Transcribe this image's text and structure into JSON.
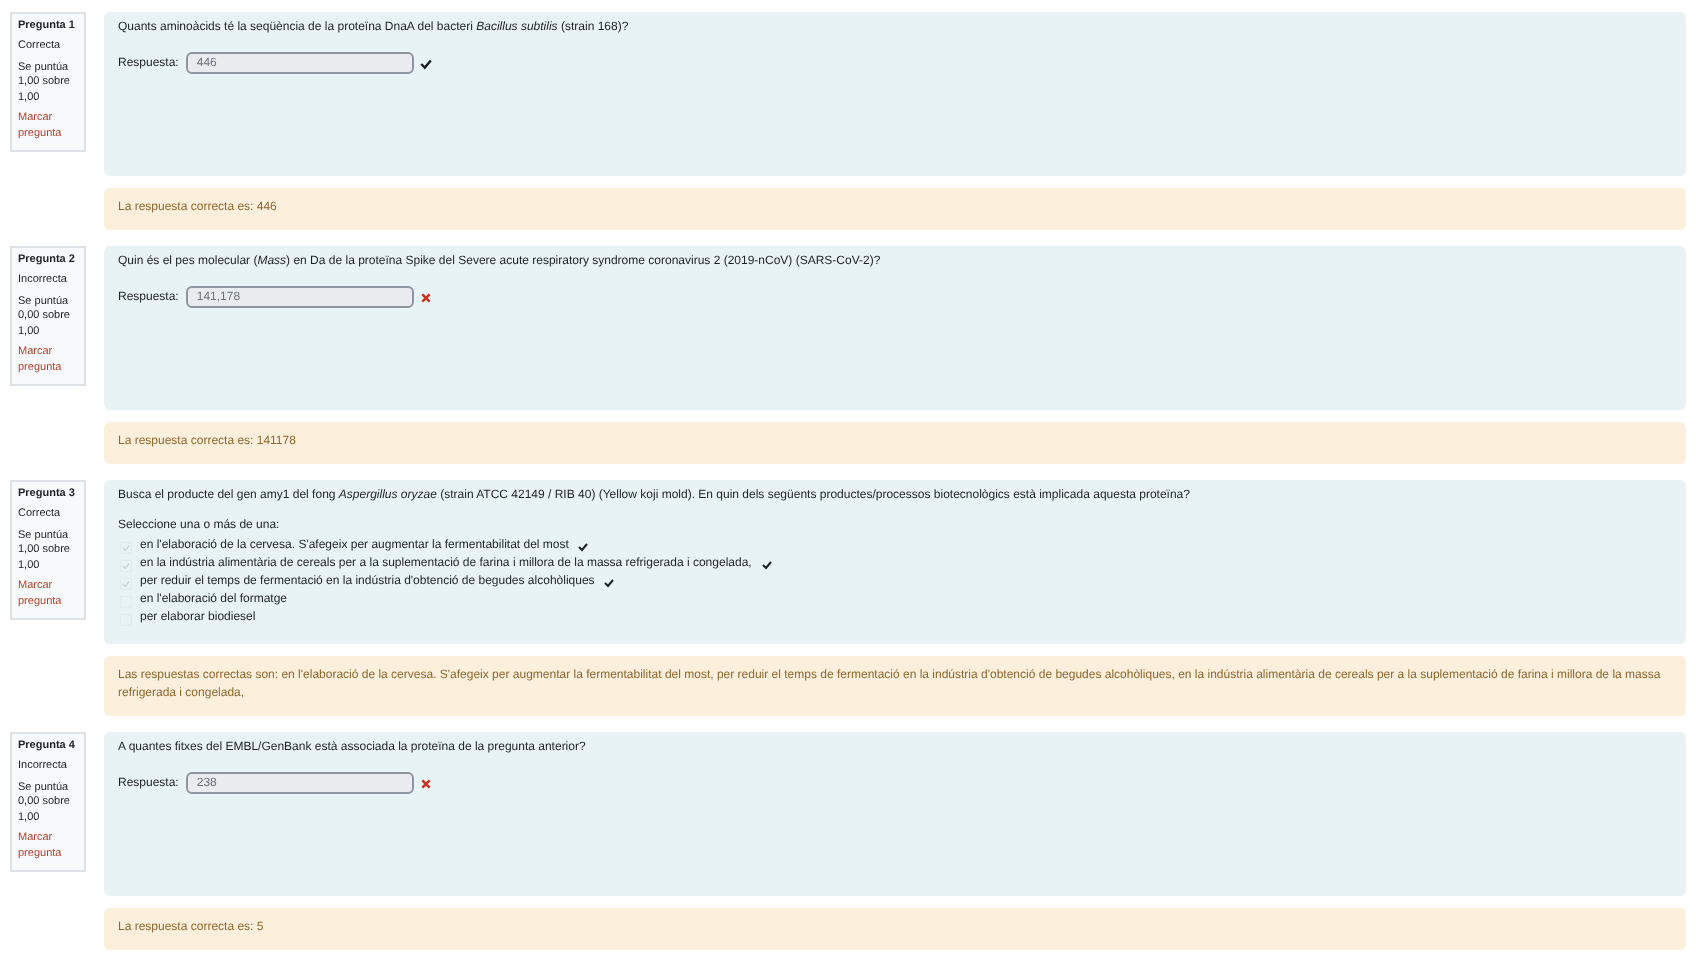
{
  "questions": [
    {
      "number": "Pregunta 1",
      "status": "Correcta",
      "score": "Se puntúa 1,00 sobre 1,00",
      "flag": "Marcar pregunta",
      "kind": "short",
      "prompt": "Quants aminoàcids té la seqüència de la proteïna DnaA del bacteri *Bacillus subtilis* (strain 168)?",
      "answer_label": "Respuesta:",
      "answer": "446",
      "correct": true,
      "feedback": "La respuesta correcta es: 446"
    },
    {
      "number": "Pregunta 2",
      "status": "Incorrecta",
      "score": "Se puntúa 0,00 sobre 1,00",
      "flag": "Marcar pregunta",
      "kind": "short",
      "prompt": "Quin és el pes molecular (*Mass*) en Da de la proteïna Spike del Severe acute respiratory syndrome coronavirus 2 (2019-nCoV) (SARS-CoV-2)?",
      "answer_label": "Respuesta:",
      "answer": "141,178",
      "correct": false,
      "feedback": "La respuesta correcta es: 141178"
    },
    {
      "number": "Pregunta 3",
      "status": "Correcta",
      "score": "Se puntúa 1,00 sobre 1,00",
      "flag": "Marcar pregunta",
      "kind": "multi",
      "prompt": "Busca el producte del gen amy1 del fong *Aspergillus oryzae* (strain ATCC 42149 / RIB 40) (Yellow koji mold). En quin dels següents productes/processos biotecnològics està implicada aquesta proteïna?",
      "instruction": "Seleccione una o más de una:",
      "options": [
        {
          "label": "en l'elaboració de la cervesa. S'afegeix per augmentar la fermentabilitat del most",
          "checked": true
        },
        {
          "label": "en la indústria alimentària de cereals per a la suplementació de farina i millora de la massa refrigerada i congelada,",
          "checked": true
        },
        {
          "label": "per reduir el temps de fermentació en la indústria d'obtenció de begudes alcohòliques",
          "checked": true
        },
        {
          "label": "en l'elaboració del formatge",
          "checked": false
        },
        {
          "label": "per elaborar biodiesel",
          "checked": false
        }
      ],
      "feedback": "Las respuestas correctas son: en l'elaboració de la cervesa. S'afegeix per augmentar la fermentabilitat del most, per reduir el temps de fermentació en la indústria d'obtenció de begudes alcohòliques, en la indústria alimentària de cereals per a la suplementació de farina i millora de la massa refrigerada i congelada,"
    },
    {
      "number": "Pregunta 4",
      "status": "Incorrecta",
      "score": "Se puntúa 0,00 sobre 1,00",
      "flag": "Marcar pregunta",
      "kind": "short",
      "prompt": "A quantes fitxes del EMBL/GenBank està associada la proteïna de la pregunta anterior?",
      "answer_label": "Respuesta:",
      "answer": "238",
      "correct": false,
      "feedback": "La respuesta correcta es: 5"
    }
  ]
}
